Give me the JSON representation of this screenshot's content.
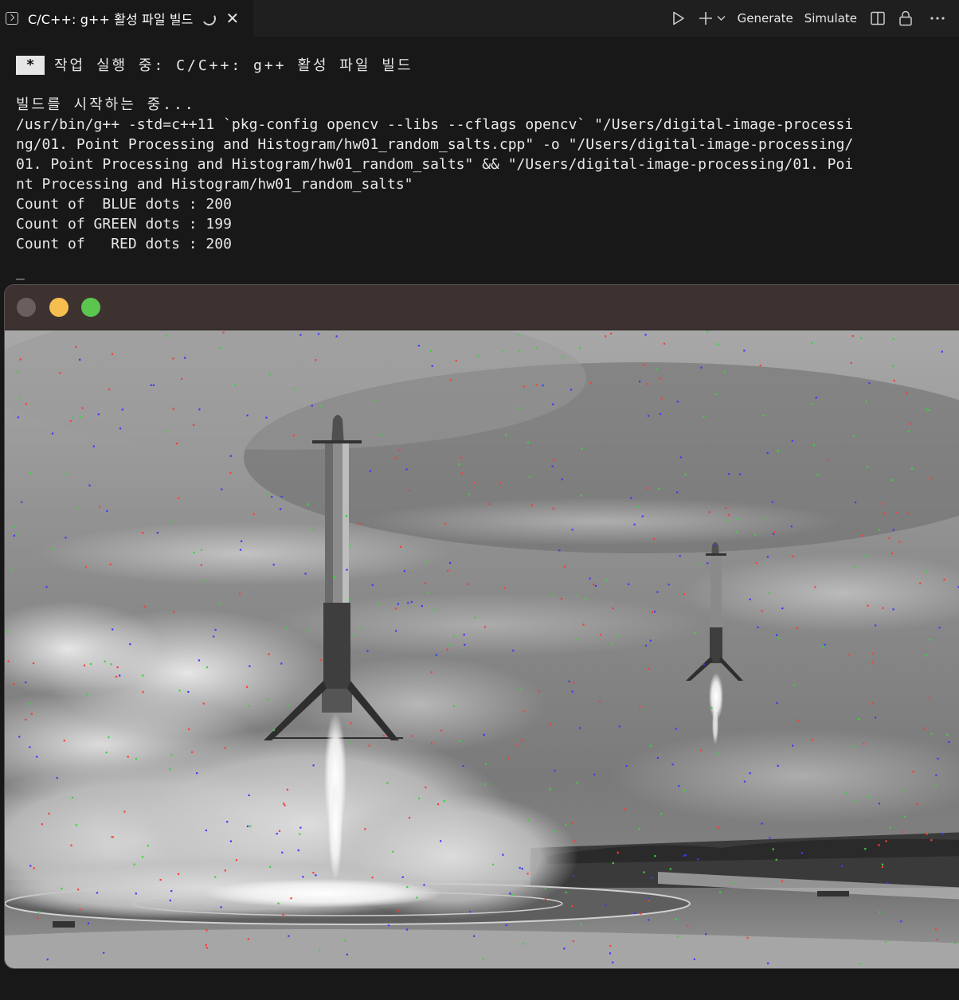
{
  "tab": {
    "title": "C/C++: g++ 활성 파일 빌드",
    "spinner_icon": "loading-spinner-icon",
    "close_icon": "close-icon"
  },
  "toolbar": {
    "run_icon": "play-icon",
    "add_icon": "plus-icon",
    "dropdown_icon": "chevron-down-icon",
    "generate_label": "Generate",
    "simulate_label": "Simulate",
    "split_icon": "split-editor-icon",
    "lock_icon": "lock-icon",
    "more_icon": "ellipsis-icon"
  },
  "terminal": {
    "star": "*",
    "task_label": "작업 실행 중: C/C++: g++ 활성 파일 빌드",
    "start_label": "빌드를 시작하는 중...",
    "command_lines": [
      "/usr/bin/g++ -std=c++11 `pkg-config opencv --libs --cflags opencv` \"/Users/digital-image-processi",
      "ng/01. Point Processing and Histogram/hw01_random_salts.cpp\" -o \"/Users/digital-image-processing/",
      "01. Point Processing and Histogram/hw01_random_salts\" && \"/Users/digital-image-processing/01. Poi",
      "nt Processing and Histogram/hw01_random_salts\""
    ],
    "output_lines": [
      "Count of  BLUE dots : 200",
      "Count of GREEN dots : 199",
      "Count of   RED dots : 200"
    ],
    "cursor": "_"
  },
  "image_window": {
    "image_description_icon": "rocket-landing-photo",
    "colors": {
      "titlebar": "#3e3230",
      "close": "#6a5f5e",
      "minimize": "#f6be4f",
      "maximize": "#5bc64f",
      "salt_blue": "#3a3aff",
      "salt_green": "#3bd23b",
      "salt_red": "#ff3a3a"
    },
    "salt_counts": {
      "blue": 200,
      "green": 199,
      "red": 200
    }
  }
}
